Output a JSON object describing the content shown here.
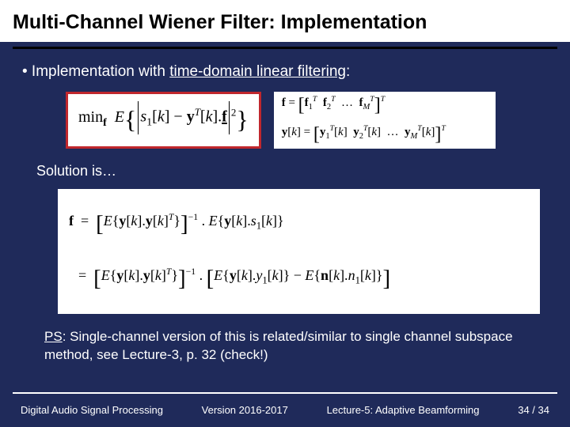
{
  "title": "Multi-Channel Wiener Filter: Implementation",
  "bullet": {
    "prefix": "• Implementation with  ",
    "underlined": "time-domain linear filtering",
    "suffix": ":"
  },
  "eq_main": "min_f  E{ | s₁[k] − yᵀ[k]·f |² }",
  "def_f": "f = [ f₁ᵀ   f₂ᵀ   …   f_Mᵀ ]ᵀ",
  "def_y": "y[k] = [ y₁ᵀ[k]   y₂ᵀ[k]   …   y_Mᵀ[k] ]ᵀ",
  "solution_label": "Solution is…",
  "sol_line1": "f  =  [ E{ y[k]·y[k]ᵀ } ]⁻¹ · E{ y[k]·s₁[k] }",
  "sol_line2": "   =  [ E{ y[k]·y[k]ᵀ } ]⁻¹ · [ E{ y[k]·y₁[k] } − E{ n[k]·n₁[k] } ]",
  "ps": {
    "label": "PS",
    "text": ":  Single-channel version of this is related/similar to single channel subspace method, see Lecture-3, p. 32 (check!)"
  },
  "footer": {
    "left": "Digital Audio Signal Processing",
    "center": "Version 2016-2017",
    "right": "Lecture-5: Adaptive Beamforming",
    "page": "34 / 34"
  }
}
